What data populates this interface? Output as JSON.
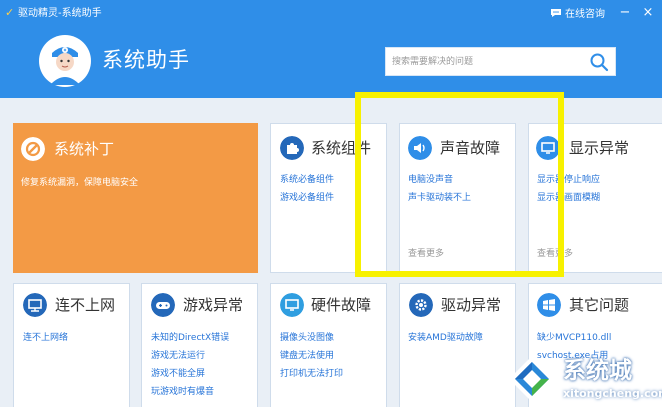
{
  "window": {
    "title": "驱动精灵-系统助手",
    "online_consult": "在线咨询",
    "minimize": "−",
    "close": "×"
  },
  "header": {
    "title": "系统助手",
    "search_placeholder": "搜索需要解决的问题"
  },
  "cards": {
    "patch": {
      "title": "系统补丁",
      "desc": "修复系统漏洞，保障电脑安全"
    },
    "component": {
      "title": "系统组件",
      "links": [
        "系统必备组件",
        "游戏必备组件"
      ]
    },
    "sound": {
      "title": "声音故障",
      "links": [
        "电脑没声音",
        "声卡驱动装不上"
      ],
      "more": "查看更多"
    },
    "display": {
      "title": "显示异常",
      "links": [
        "显示器停止响应",
        "显示器画面模糊"
      ],
      "more": "查看更多"
    },
    "network": {
      "title": "连不上网",
      "links": [
        "连不上网络"
      ]
    },
    "game": {
      "title": "游戏异常",
      "links": [
        "未知的DirectX错误",
        "游戏无法运行",
        "游戏不能全屏",
        "玩游戏时有爆音"
      ]
    },
    "hardware": {
      "title": "硬件故障",
      "links": [
        "摄像头没图像",
        "键盘无法使用",
        "打印机无法打印"
      ]
    },
    "driver": {
      "title": "驱动异常",
      "links": [
        "安装AMD驱动故障"
      ]
    },
    "other": {
      "title": "其它问题",
      "links": [
        "缺少MVCP110.dll",
        "svchost.exe占用"
      ]
    }
  },
  "watermark": {
    "text": "系统城",
    "url": "xitongcheng.com"
  },
  "colors": {
    "primary": "#2f8ee8",
    "orange": "#f39a45",
    "highlight": "#f7f100"
  },
  "icons": {
    "titlebar": "app-logo-icon",
    "online": "chat-bubble-icon",
    "search": "search-icon",
    "patch": "wrench-gear-icon",
    "component": "puzzle-icon",
    "sound": "speaker-icon",
    "display": "monitor-icon",
    "network": "network-icon",
    "game": "gamepad-icon",
    "hardware": "monitor-icon",
    "driver": "gear-icon",
    "other": "windows-icon"
  }
}
